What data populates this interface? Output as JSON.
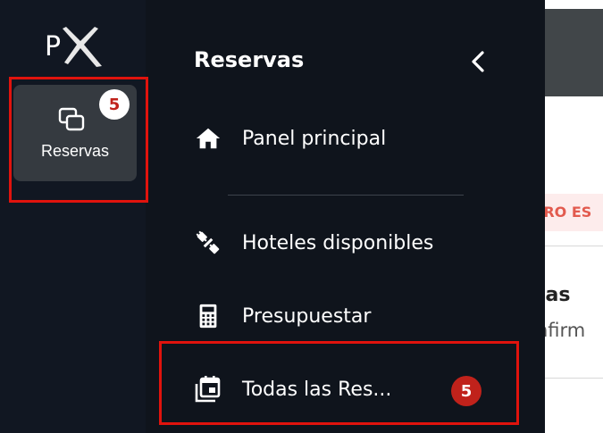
{
  "logo": {
    "text": "PX"
  },
  "rail": {
    "items": [
      {
        "label": "Reservas",
        "icon": "reservations-icon",
        "badge": "5"
      }
    ]
  },
  "drawer": {
    "title": "Reservas",
    "collapse_icon": "chevron-left-icon",
    "items": [
      {
        "label": "Panel principal",
        "icon": "home-icon"
      },
      {
        "label": "Hoteles disponibles",
        "icon": "plug-icon"
      },
      {
        "label": "Presupuestar",
        "icon": "calculator-icon"
      },
      {
        "label": "Todas las Res...",
        "icon": "calendar-icon",
        "badge": "5"
      }
    ]
  },
  "content": {
    "alert_text": "RRO ES",
    "heading_fragment": "tas",
    "subtext_fragment": "nfirm"
  },
  "colors": {
    "highlight": "#e0130d",
    "badge_red": "#c0221b",
    "sidebar_bg": "#111722",
    "drawer_bg": "#0f141c"
  }
}
